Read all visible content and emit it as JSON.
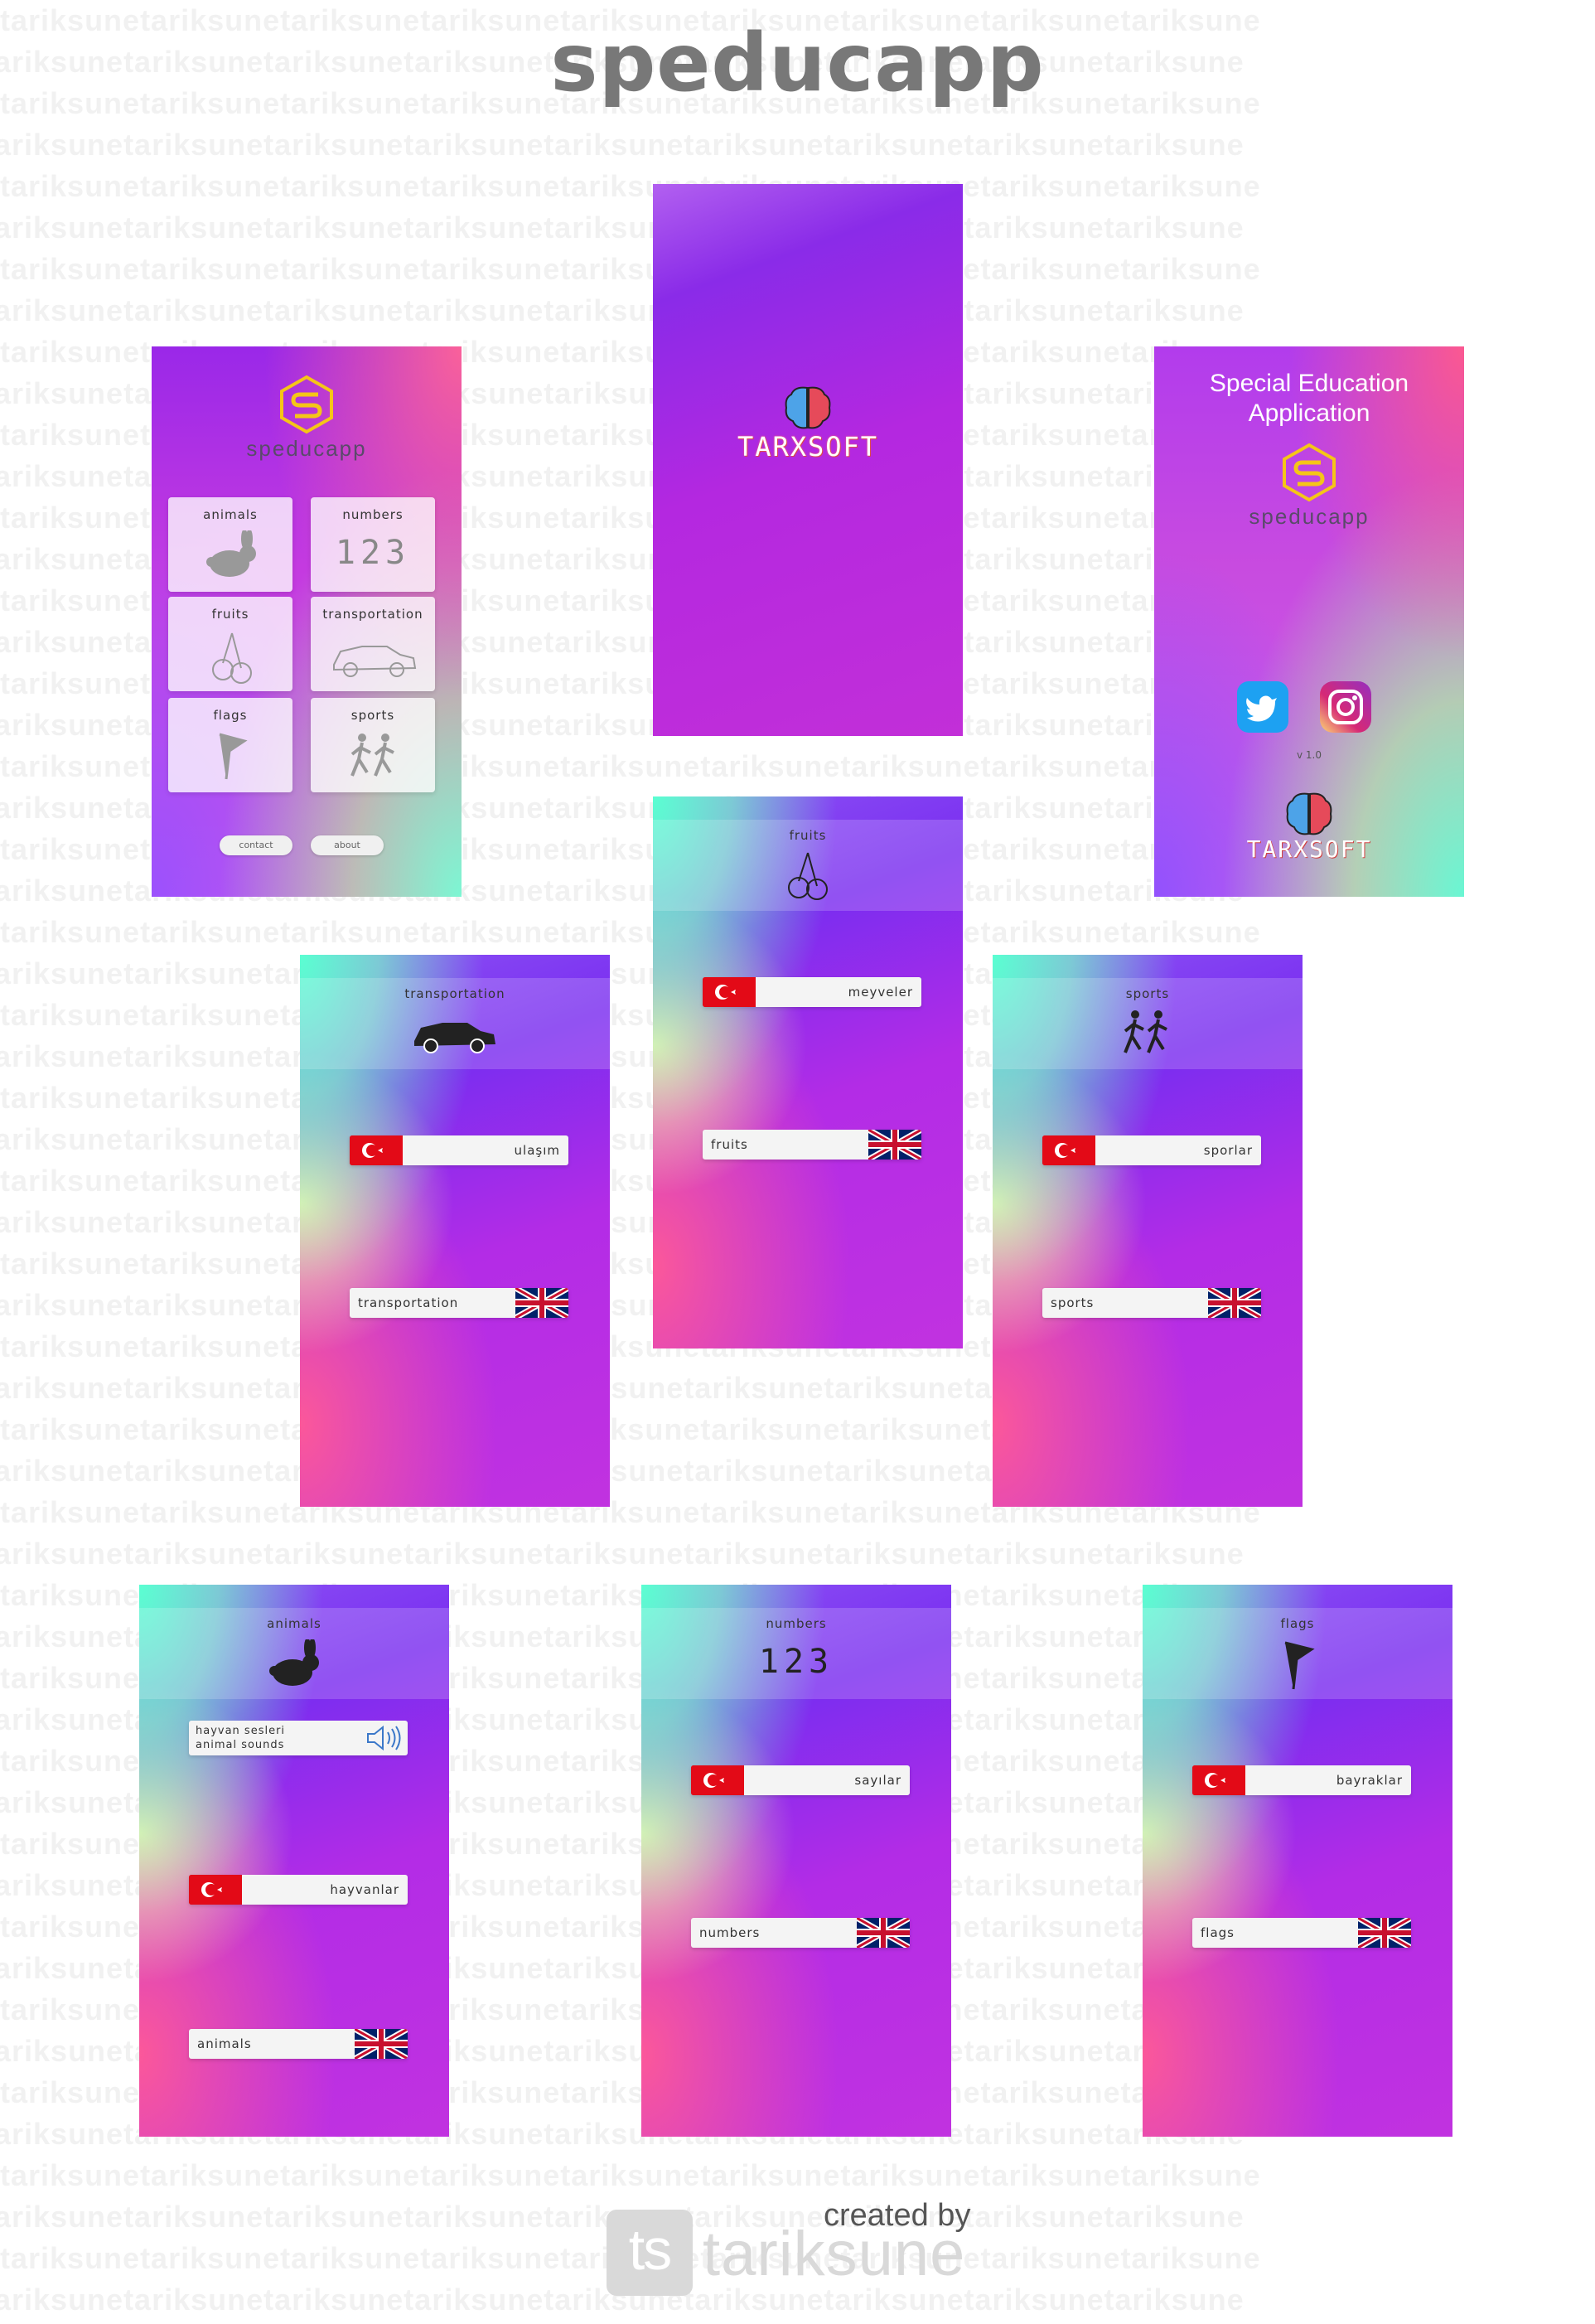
{
  "app_title": "speducapp",
  "watermark_text": "tariksunetariksunetariksunetariksunetariksunetariksunetariksunetariksunetariksune",
  "main_menu": {
    "brand": "speducapp",
    "tiles": [
      {
        "label": "animals"
      },
      {
        "label": "numbers",
        "glyph": "123"
      },
      {
        "label": "fruits"
      },
      {
        "label": "transportation"
      },
      {
        "label": "flags"
      },
      {
        "label": "sports"
      }
    ],
    "contact_label": "contact",
    "about_label": "about"
  },
  "splash": {
    "brand": "TARXSOFT"
  },
  "about": {
    "line1": "Special Education",
    "line2": "Application",
    "brand": "speducapp",
    "version": "v 1.0",
    "company": "TARXSOFT"
  },
  "fruits_screen": {
    "title": "fruits",
    "tr_label": "meyveler",
    "en_label": "fruits"
  },
  "transportation_screen": {
    "title": "transportation",
    "tr_label": "ulaşım",
    "en_label": "transportation"
  },
  "sports_screen": {
    "title": "sports",
    "tr_label": "sporlar",
    "en_label": "sports"
  },
  "animals_screen": {
    "title": "animals",
    "sound_line1": "hayvan sesleri",
    "sound_line2": "animal sounds",
    "tr_label": "hayvanlar",
    "en_label": "animals"
  },
  "numbers_screen": {
    "title": "numbers",
    "glyph": "123",
    "tr_label": "sayılar",
    "en_label": "numbers"
  },
  "flags_screen": {
    "title": "flags",
    "tr_label": "bayraklar",
    "en_label": "flags"
  },
  "footer": {
    "created_by": "created by",
    "author": "tariksune",
    "logo_initials": "ts"
  },
  "colors": {
    "title_gray": "#787878",
    "logo_yellow": "#f5c518",
    "flag_red": "#e30a17",
    "twitter_blue": "#1da1f2"
  }
}
